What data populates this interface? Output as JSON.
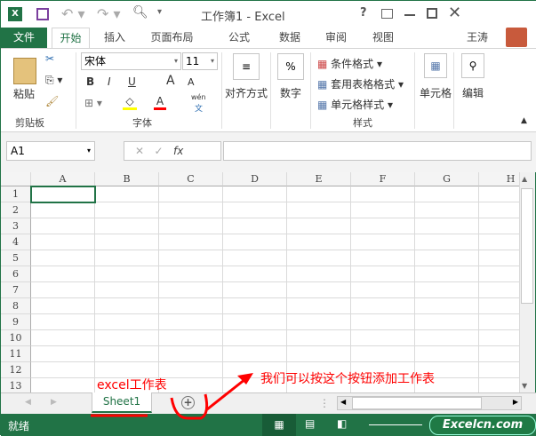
{
  "window": {
    "title": "工作簿1 - Excel",
    "help": "?",
    "user": "王涛"
  },
  "tabs": [
    {
      "label": "文件"
    },
    {
      "label": "开始"
    },
    {
      "label": "插入"
    },
    {
      "label": "页面布局"
    },
    {
      "label": "公式"
    },
    {
      "label": "数据"
    },
    {
      "label": "审阅"
    },
    {
      "label": "视图"
    }
  ],
  "ribbon": {
    "clipboard": {
      "paste": "粘贴",
      "label": "剪贴板"
    },
    "font": {
      "name": "宋体",
      "size": "11",
      "bold": "B",
      "italic": "I",
      "underline": "U",
      "grow": "A",
      "shrink": "A",
      "color_a": "A",
      "phonetic_top": "wén",
      "phonetic_bottom": "文",
      "label": "字体"
    },
    "align": {
      "label": "对齐方式"
    },
    "number": {
      "symbol": "%",
      "label": "数字"
    },
    "styles": {
      "cond": "条件格式",
      "table": "套用表格格式",
      "cell": "单元格样式",
      "label": "样式"
    },
    "cells": {
      "label": "单元格"
    },
    "edit": {
      "label": "编辑"
    }
  },
  "formula": {
    "namebox": "A1",
    "fx": "fx",
    "value": ""
  },
  "grid": {
    "columns": [
      "A",
      "B",
      "C",
      "D",
      "E",
      "F",
      "G",
      "H"
    ],
    "rows": [
      "1",
      "2",
      "3",
      "4",
      "5",
      "6",
      "7",
      "8",
      "9",
      "10",
      "11",
      "12",
      "13"
    ],
    "active_cell": "A1"
  },
  "sheets": [
    {
      "name": "Sheet1",
      "active": true
    }
  ],
  "annotations": {
    "sheet_label": "excel工作表",
    "add_hint": "我们可以按这个按钮添加工作表"
  },
  "status": {
    "ready": "就绪",
    "watermark": "Excelcn.com"
  },
  "colors": {
    "brand": "#217346",
    "annotation": "#ff0000"
  }
}
